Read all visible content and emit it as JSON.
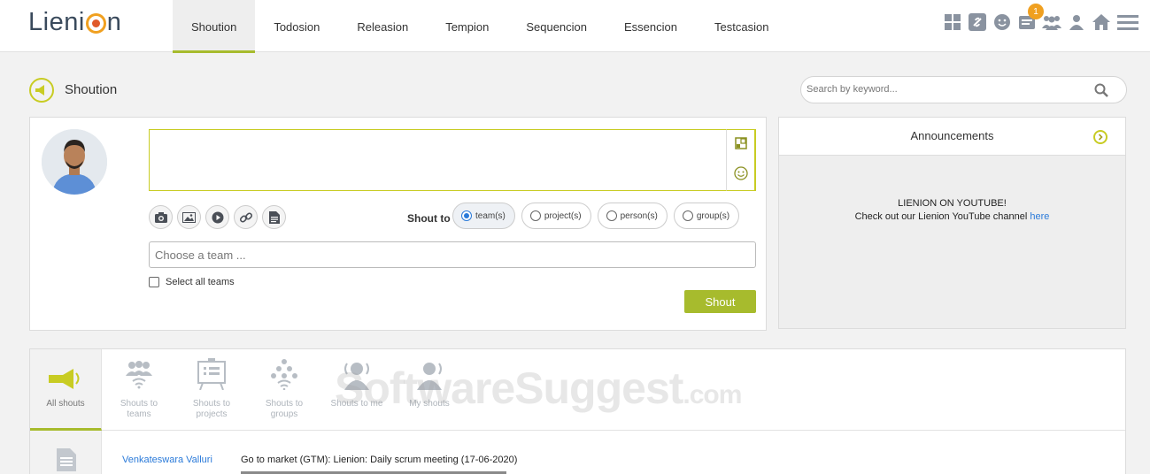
{
  "app": {
    "logo_text_left": "Lieni",
    "logo_text_right": "n"
  },
  "nav": {
    "tabs": [
      {
        "label": "Shoution",
        "active": true
      },
      {
        "label": "Todosion",
        "active": false
      },
      {
        "label": "Releasion",
        "active": false
      },
      {
        "label": "Tempion",
        "active": false
      },
      {
        "label": "Sequencion",
        "active": false
      },
      {
        "label": "Essencion",
        "active": false
      },
      {
        "label": "Testcasion",
        "active": false
      }
    ]
  },
  "top_icons": {
    "notification_count": "1",
    "icons": [
      "apps-grid-icon",
      "link-icon",
      "smiley-icon",
      "notes-icon",
      "team-icon",
      "user-icon",
      "home-icon",
      "menu-icon"
    ]
  },
  "page": {
    "title": "Shoution",
    "search_placeholder": "Search by keyword..."
  },
  "compose": {
    "shout_to_label": "Shout to",
    "targets": [
      {
        "label": "team(s)",
        "selected": true
      },
      {
        "label": "project(s)",
        "selected": false
      },
      {
        "label": "person(s)",
        "selected": false
      },
      {
        "label": "group(s)",
        "selected": false
      }
    ],
    "team_placeholder": "Choose a team ...",
    "select_all_label": "Select all teams",
    "submit_label": "Shout"
  },
  "announcements": {
    "title": "Announcements",
    "line1": "LIENION ON YOUTUBE!",
    "line2_prefix": "Check out our Lienion YouTube channel ",
    "line2_link": "here"
  },
  "feed": {
    "tabs": [
      {
        "label_1": "All shouts",
        "label_2": "",
        "active": true
      },
      {
        "label_1": "Shouts to",
        "label_2": "teams",
        "active": false
      },
      {
        "label_1": "Shouts to",
        "label_2": "projects",
        "active": false
      },
      {
        "label_1": "Shouts to",
        "label_2": "groups",
        "active": false
      },
      {
        "label_1": "Shouts to me",
        "label_2": "",
        "active": false
      },
      {
        "label_1": "My shouts",
        "label_2": "",
        "active": false
      }
    ],
    "items": [
      {
        "author": "Venkateswara Valluri",
        "text": "Go to market (GTM): Lienion: Daily scrum meeting (17-06-2020)"
      }
    ]
  },
  "watermark": {
    "text": "SoftwareSuggest",
    "suffix": ".com"
  },
  "colors": {
    "accent": "#a7bb2d",
    "accent_ring": "#c8cc23",
    "link": "#2a7ad9",
    "badge": "#f0a020"
  }
}
